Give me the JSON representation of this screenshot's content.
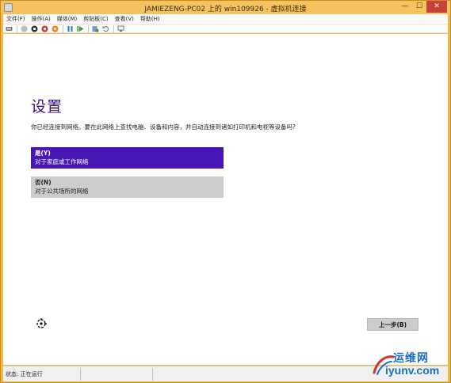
{
  "window": {
    "title": "JAMIEZENG-PC02 上的 win109926 - 虚拟机连接",
    "minimize": "—",
    "maximize": "☐",
    "close": "✕"
  },
  "menubar": {
    "items": [
      {
        "label": "文件(F)"
      },
      {
        "label": "操作(A)"
      },
      {
        "label": "媒体(M)"
      },
      {
        "label": "剪贴板(C)"
      },
      {
        "label": "查看(V)"
      },
      {
        "label": "帮助(H)"
      }
    ]
  },
  "toolbar": {
    "icons": [
      "ctrl-alt-del-icon",
      "start-icon",
      "turn-off-icon",
      "shut-down-icon",
      "save-icon",
      "pause-icon",
      "resume-icon",
      "checkpoint-icon",
      "revert-icon",
      "enhanced-session-icon"
    ]
  },
  "oobe": {
    "title": "设置",
    "question": "你已经连接到网络。要在此网络上查找电脑、设备和内容，并自动连接到诸如打印机和电视等设备吗?",
    "yes": {
      "title": "是(Y)",
      "desc": "对于家庭或工作网络"
    },
    "no": {
      "title": "否(N)",
      "desc": "对于公共场所的网络"
    },
    "back_label": "上一步(B)"
  },
  "statusbar": {
    "status": "状态: 正在运行"
  },
  "watermark": {
    "line1": "运维网",
    "line2": "iyunv.com"
  },
  "colors": {
    "accent": "#4617b4",
    "title": "#3a0c92",
    "frame": "#f2b84a"
  }
}
